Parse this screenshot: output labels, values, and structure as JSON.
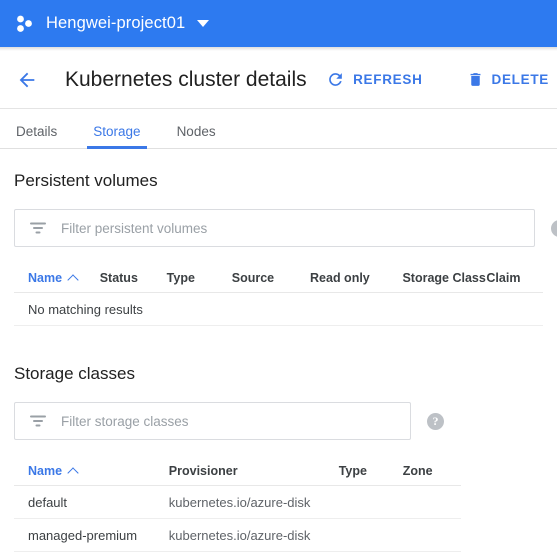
{
  "appbar": {
    "project_icon": "project-dots-icon",
    "project_name": "Hengwei-project01",
    "caret_icon": "chevron-down-icon",
    "background_color": "#2d7af0"
  },
  "page_header": {
    "back_icon": "arrow-left-icon",
    "title": "Kubernetes cluster details",
    "actions": [
      {
        "label": "REFRESH",
        "icon": "refresh-icon"
      },
      {
        "label": "DELETE",
        "icon": "trash-icon"
      }
    ],
    "accent_color": "#3b78e7"
  },
  "tabs": [
    {
      "label": "Details",
      "active": false
    },
    {
      "label": "Storage",
      "active": true
    },
    {
      "label": "Nodes",
      "active": false
    }
  ],
  "persistent_volumes": {
    "section_title": "Persistent volumes",
    "filter": {
      "placeholder": "Filter persistent volumes",
      "value": "",
      "icon": "filter-icon"
    },
    "help_icon": "help-circle-icon",
    "columns": [
      "Name",
      "Status",
      "Type",
      "Source",
      "Read only",
      "Storage Class",
      "Claim"
    ],
    "sorted_column": "Name",
    "sort_direction": "asc",
    "rows": [],
    "empty_message": "No matching results"
  },
  "storage_classes": {
    "section_title": "Storage classes",
    "filter": {
      "placeholder": "Filter storage classes",
      "value": "",
      "icon": "filter-icon"
    },
    "help_icon": "help-circle-icon",
    "columns": [
      "Name",
      "Provisioner",
      "Type",
      "Zone"
    ],
    "sorted_column": "Name",
    "sort_direction": "asc",
    "rows": [
      {
        "name": "default",
        "provisioner": "kubernetes.io/azure-disk",
        "type": "",
        "zone": ""
      },
      {
        "name": "managed-premium",
        "provisioner": "kubernetes.io/azure-disk",
        "type": "",
        "zone": ""
      }
    ]
  }
}
